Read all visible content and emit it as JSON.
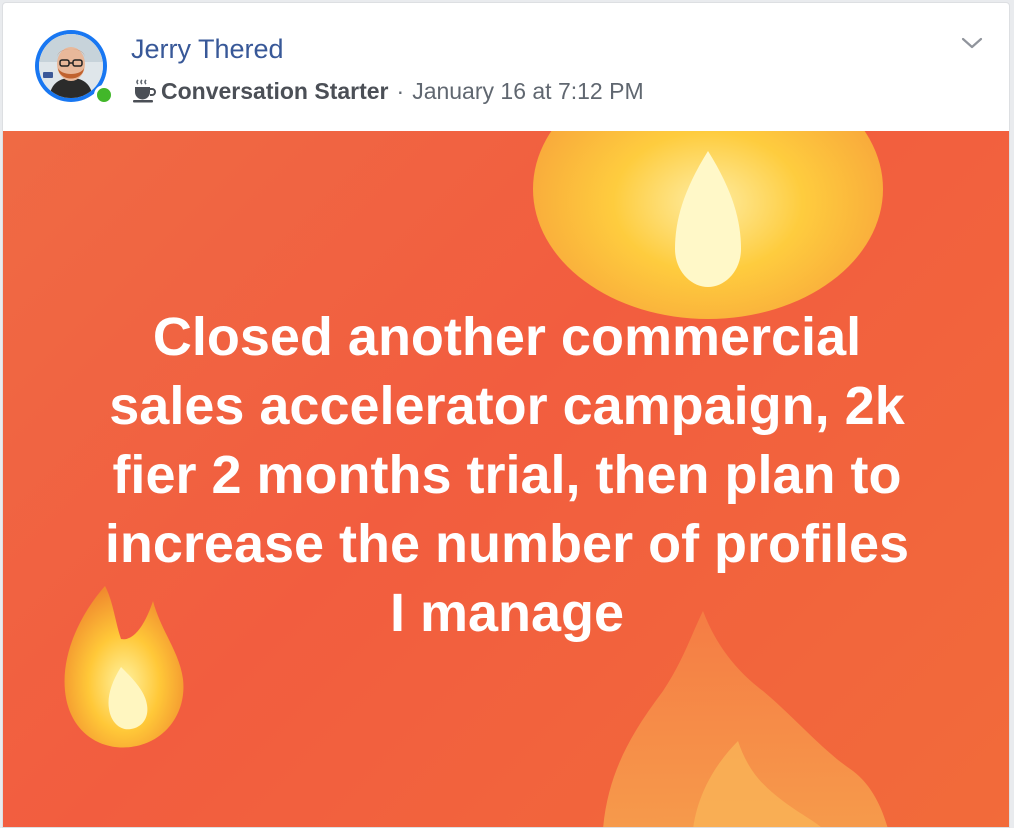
{
  "post": {
    "author": {
      "name": "Jerry Thered",
      "online": true
    },
    "badge": {
      "icon": "coffee-cup-icon",
      "label": "Conversation Starter"
    },
    "separator": "·",
    "timestamp": "January 16 at 7:12 PM",
    "menu_icon": "chevron-down-icon",
    "text_lines": [
      "Closed another commercial",
      "sales accelerator campaign, 2k",
      "fier 2 months trial, then plan to",
      "increase the number of profiles",
      "I manage"
    ],
    "background": {
      "theme": "fire",
      "color_top": "#ef6a44",
      "color_bottom": "#f26b3a",
      "decor_icon": "flame-icon"
    }
  }
}
